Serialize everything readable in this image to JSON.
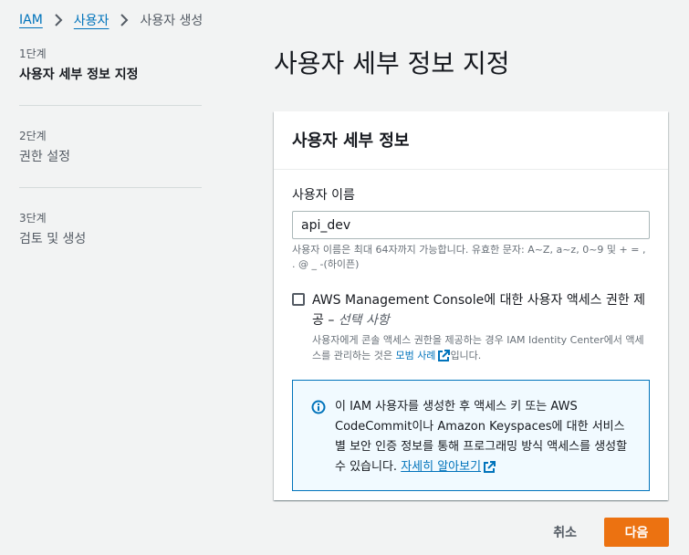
{
  "breadcrumb": {
    "items": [
      "IAM",
      "사용자"
    ],
    "current": "사용자 생성"
  },
  "steps": [
    {
      "num": "1단계",
      "title": "사용자 세부 정보 지정",
      "active": true
    },
    {
      "num": "2단계",
      "title": "권한 설정",
      "active": false
    },
    {
      "num": "3단계",
      "title": "검토 및 생성",
      "active": false
    }
  ],
  "page_title": "사용자 세부 정보 지정",
  "panel": {
    "title": "사용자 세부 정보",
    "username_label": "사용자 이름",
    "username_value": "api_dev",
    "username_constraint": "사용자 이름은 최대 64자까지 가능합니다. 유효한 문자: A~Z, a~z, 0~9 및 + = , . @ _ -(하이픈)",
    "console_checkbox": {
      "label": "AWS Management Console에 대한 사용자 액세스 권한 제공 – ",
      "optional": "선택 사항",
      "checked": false,
      "desc_before": "사용자에게 콘솔 액세스 권한을 제공하는 경우 IAM Identity Center에서 액세스를 관리하는 것은 ",
      "desc_link": "모범 사례",
      "desc_after": "입니다."
    },
    "info": {
      "text": "이 IAM 사용자를 생성한 후 액세스 키 또는 AWS CodeCommit이나 Amazon Keyspaces에 대한 서비스별 보안 인증 정보를 통해 프로그래밍 방식 액세스를 생성할 수 있습니다. ",
      "link": "자세히 알아보기"
    }
  },
  "footer": {
    "cancel_label": "취소",
    "next_label": "다음"
  },
  "colors": {
    "link": "#0073bb",
    "primary": "#ec7211",
    "info_bg": "#f1faff"
  },
  "icons": [
    "chevron-right-icon",
    "info-icon",
    "external-link-icon"
  ]
}
